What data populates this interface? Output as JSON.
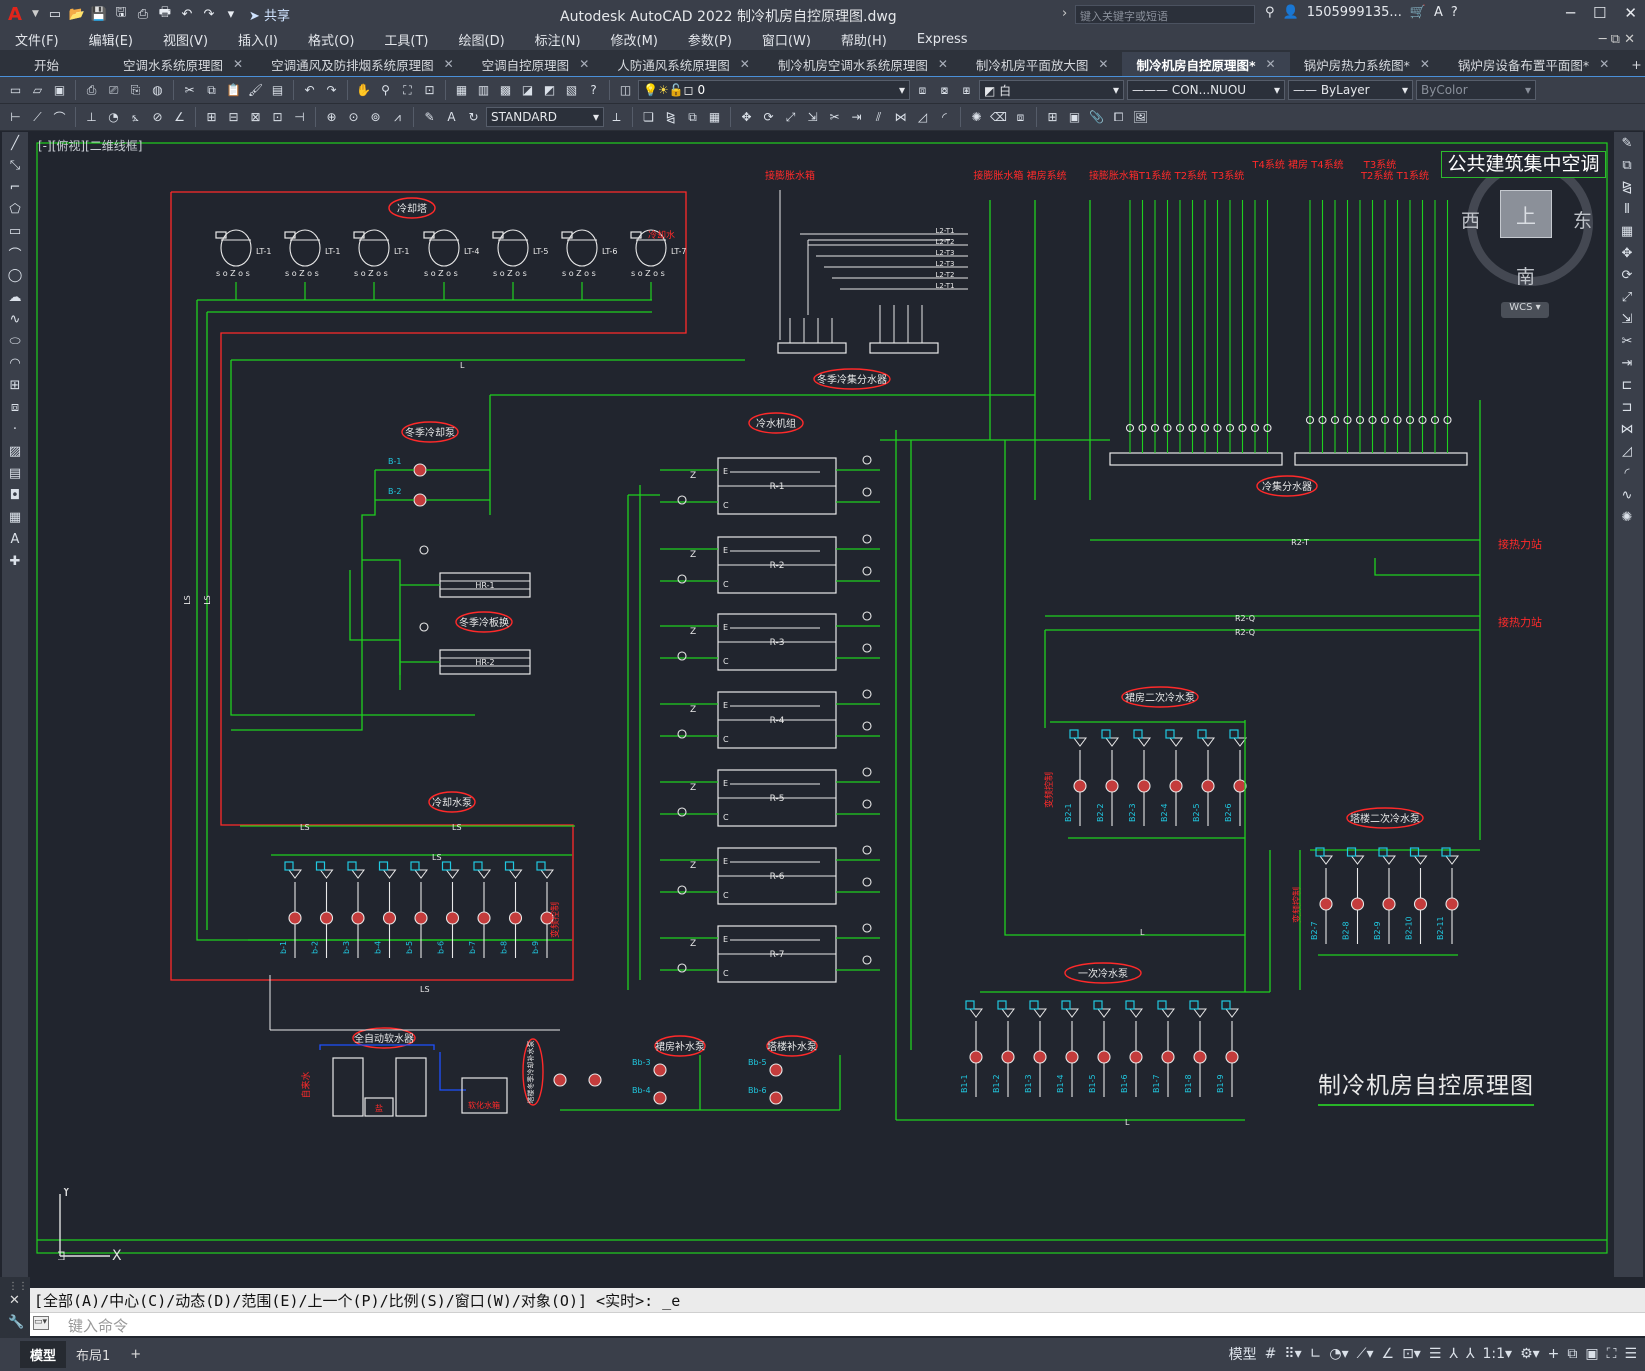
{
  "app": {
    "logo": "A",
    "title": "Autodesk AutoCAD 2022    制冷机房自控原理图.dwg",
    "share": "共享",
    "search_placeholder": "键入关键字或短语",
    "user": "1505999135...",
    "help": "?"
  },
  "menu": [
    "文件(F)",
    "编辑(E)",
    "视图(V)",
    "插入(I)",
    "格式(O)",
    "工具(T)",
    "绘图(D)",
    "标注(N)",
    "修改(M)",
    "参数(P)",
    "窗口(W)",
    "帮助(H)",
    "Express"
  ],
  "tabs": [
    {
      "label": "开始",
      "close": false,
      "active": false
    },
    {
      "label": "空调水系统原理图",
      "close": true,
      "active": false
    },
    {
      "label": "空调通风及防排烟系统原理图",
      "close": true,
      "active": false
    },
    {
      "label": "空调自控原理图",
      "close": true,
      "active": false
    },
    {
      "label": "人防通风系统原理图",
      "close": true,
      "active": false
    },
    {
      "label": "制冷机房空调水系统原理图",
      "close": true,
      "active": false
    },
    {
      "label": "制冷机房平面放大图",
      "close": true,
      "active": false
    },
    {
      "label": "制冷机房自控原理图*",
      "close": true,
      "active": true
    },
    {
      "label": "锅炉房热力系统图*",
      "close": true,
      "active": false
    },
    {
      "label": "锅炉房设备布置平面图*",
      "close": true,
      "active": false
    }
  ],
  "toolbar": {
    "layer": "0",
    "color": "白",
    "linetype": "CON...NUOU",
    "lineweight": "ByLayer",
    "plotstyle": "ByColor",
    "textstyle": "STANDARD"
  },
  "viewport": {
    "label": "[-][俯视][二维线框]",
    "project": "公共建筑集中空调",
    "drawing_title": "制冷机房自控原理图"
  },
  "viewcube": {
    "top": "上",
    "west": "西",
    "east": "东",
    "south": "南",
    "wcs": "WCS"
  },
  "diagram": {
    "cooling_tower": "冷却塔",
    "cooling_tower_units": [
      "LT-1",
      "LT-1",
      "LT-1",
      "LT-4",
      "LT-5",
      "LT-6",
      "LT-7"
    ],
    "winter_cooling_pump": "冬季冷却泵",
    "winter_plate_exchanger": "冬季冷板换",
    "winter_exchangers": [
      "HR-1",
      "HR-2"
    ],
    "chiller": "冷水机组",
    "chillers": [
      "R-1",
      "R-2",
      "R-3",
      "R-4",
      "R-5",
      "R-6",
      "R-7"
    ],
    "cooling_pump": "冷却水泵",
    "cooling_pumps": [
      "b-1",
      "b-2",
      "b-3",
      "b-4",
      "b-5",
      "b-6",
      "b-7",
      "b-8",
      "b-9"
    ],
    "primary_pump": "一次冷水泵",
    "primary_pumps": [
      "B1-1",
      "B1-2",
      "B1-3",
      "B1-4",
      "B1-5",
      "B1-6",
      "B1-7",
      "B1-8",
      "B1-9"
    ],
    "podium_secondary": "裙房二次冷水泵",
    "podium_pumps": [
      "B2-1",
      "B2-2",
      "B2-3",
      "B2-4",
      "B2-5",
      "B2-6"
    ],
    "tower_secondary": "塔楼二次冷水泵",
    "tower_pumps": [
      "B2-7",
      "B2-8",
      "B2-9",
      "B2-10",
      "B2-11"
    ],
    "winter_collector": "冬季冷集分水器",
    "collector": "冷集分水器",
    "softener": "全自动软水器",
    "water_tank": "软化水箱",
    "makeup_podium": "裙房补水泵",
    "makeup_tower": "塔楼补水泵",
    "to_heat_station": "接热力站",
    "vfd": "变频控制",
    "top_labels": [
      "接膨胀水箱",
      "接膨胀水箱 裙房系统",
      "接膨胀水箱T1系统  T2系统",
      "T3系统",
      "T4系统  裙房  T4系统",
      "T3系统",
      "T2系统  T1系统"
    ],
    "pipe_L2": [
      "L2-T1",
      "L2-T2",
      "L2-T3",
      "L2-T3",
      "L2-T2",
      "L2-T1"
    ],
    "return_R2T": "R2-T",
    "return_R2Q": "R2-Q",
    "ls": "LS",
    "l": "L"
  },
  "command": {
    "line": "[全部(A)/中心(C)/动态(D)/范围(E)/上一个(P)/比例(S)/窗口(W)/对象(O)] <实时>: _e",
    "placeholder": "键入命令"
  },
  "status": {
    "model_tab": "模型",
    "layout_tab": "布局1",
    "add": "+",
    "model_btn": "模型",
    "scale": "1:1"
  },
  "colors": {
    "pipe_green": "#1fd11f",
    "red": "#ff2a2a",
    "cyan": "#20c8e0",
    "white": "#e8e8e8",
    "bg": "#21252e",
    "blue": "#1e50ff"
  }
}
